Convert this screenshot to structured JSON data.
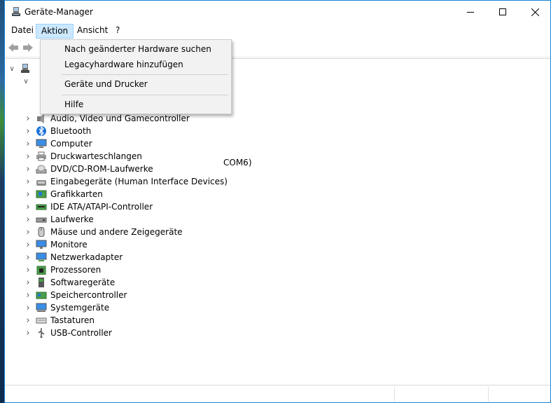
{
  "window": {
    "title": "Geräte-Manager"
  },
  "menu": {
    "datei": "Datei",
    "aktion": "Aktion",
    "ansicht": "Ansicht",
    "help": "?"
  },
  "dropdown": {
    "items": [
      "Nach geänderter Hardware suchen",
      "Legacyhardware hinzufügen",
      "Geräte und Drucker",
      "Hilfe"
    ]
  },
  "tree": {
    "partial_text": "COM6)",
    "items": [
      {
        "label": "Audio, Video und Gamecontroller",
        "icon": "audio-icon"
      },
      {
        "label": "Bluetooth",
        "icon": "bluetooth-icon"
      },
      {
        "label": "Computer",
        "icon": "computer-icon"
      },
      {
        "label": "Druckwarteschlangen",
        "icon": "printer-icon"
      },
      {
        "label": "DVD/CD-ROM-Laufwerke",
        "icon": "dvd-icon"
      },
      {
        "label": "Eingabegeräte (Human Interface Devices)",
        "icon": "hid-icon"
      },
      {
        "label": "Grafikkarten",
        "icon": "graphics-card-icon"
      },
      {
        "label": "IDE ATA/ATAPI-Controller",
        "icon": "ide-controller-icon"
      },
      {
        "label": "Laufwerke",
        "icon": "drive-icon"
      },
      {
        "label": "Mäuse und andere Zeigegeräte",
        "icon": "mouse-icon"
      },
      {
        "label": "Monitore",
        "icon": "monitor-icon"
      },
      {
        "label": "Netzwerkadapter",
        "icon": "network-adapter-icon"
      },
      {
        "label": "Prozessoren",
        "icon": "processor-icon"
      },
      {
        "label": "Softwaregeräte",
        "icon": "software-device-icon"
      },
      {
        "label": "Speichercontroller",
        "icon": "storage-controller-icon"
      },
      {
        "label": "Systemgeräte",
        "icon": "system-device-icon"
      },
      {
        "label": "Tastaturen",
        "icon": "keyboard-icon"
      },
      {
        "label": "USB-Controller",
        "icon": "usb-icon"
      }
    ]
  },
  "colors": {
    "menu_highlight": "#cce8ff",
    "window_border": "#1883d7"
  }
}
